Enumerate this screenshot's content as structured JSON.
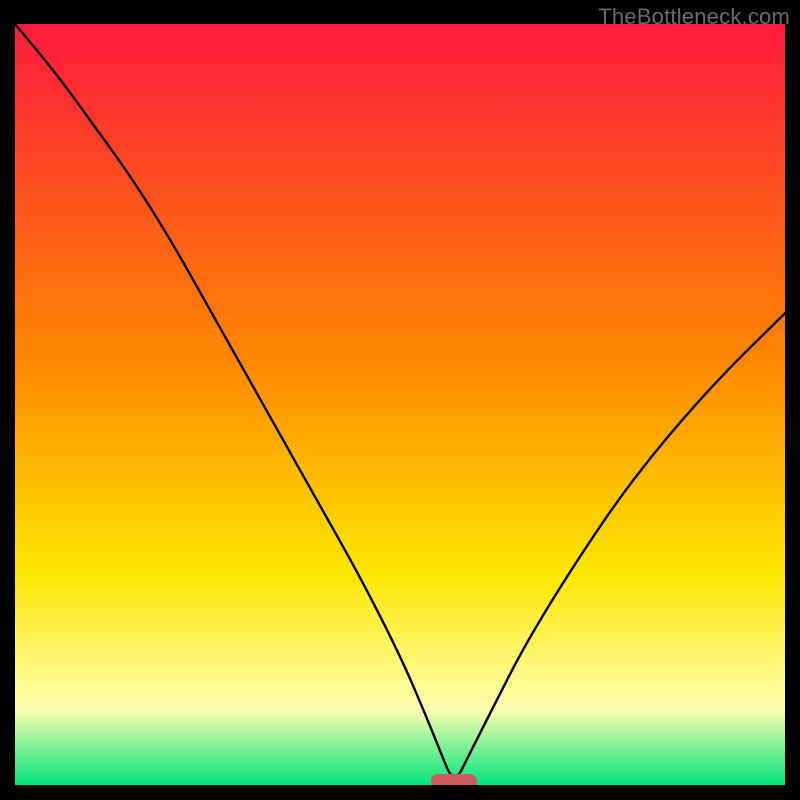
{
  "watermark": "TheBottleneck.com",
  "colors": {
    "frame": "#000000",
    "gradient_top": "#ff1a3c",
    "gradient_mid1": "#ff8a00",
    "gradient_mid2": "#ffe600",
    "gradient_pale": "#ffffb0",
    "gradient_green": "#00e47a",
    "curve": "#000000",
    "pill": "#cf5b62"
  },
  "chart_data": {
    "type": "line",
    "title": "",
    "xlabel": "",
    "ylabel": "",
    "xlim": [
      0,
      100
    ],
    "ylim": [
      0,
      100
    ],
    "optimum_x": 57,
    "series": [
      {
        "name": "bottleneck-curve",
        "x": [
          0,
          5,
          10,
          15,
          20,
          25,
          30,
          35,
          40,
          45,
          50,
          53,
          55,
          57,
          59,
          62,
          66,
          72,
          80,
          90,
          100
        ],
        "y": [
          100,
          94,
          87,
          80,
          72,
          63,
          54,
          45,
          36,
          27,
          17,
          10,
          5,
          0,
          4,
          10,
          18,
          28,
          40,
          52,
          62
        ]
      }
    ],
    "marker": {
      "x": 57,
      "y": 0,
      "shape": "pill"
    },
    "grid": false,
    "legend": false
  }
}
